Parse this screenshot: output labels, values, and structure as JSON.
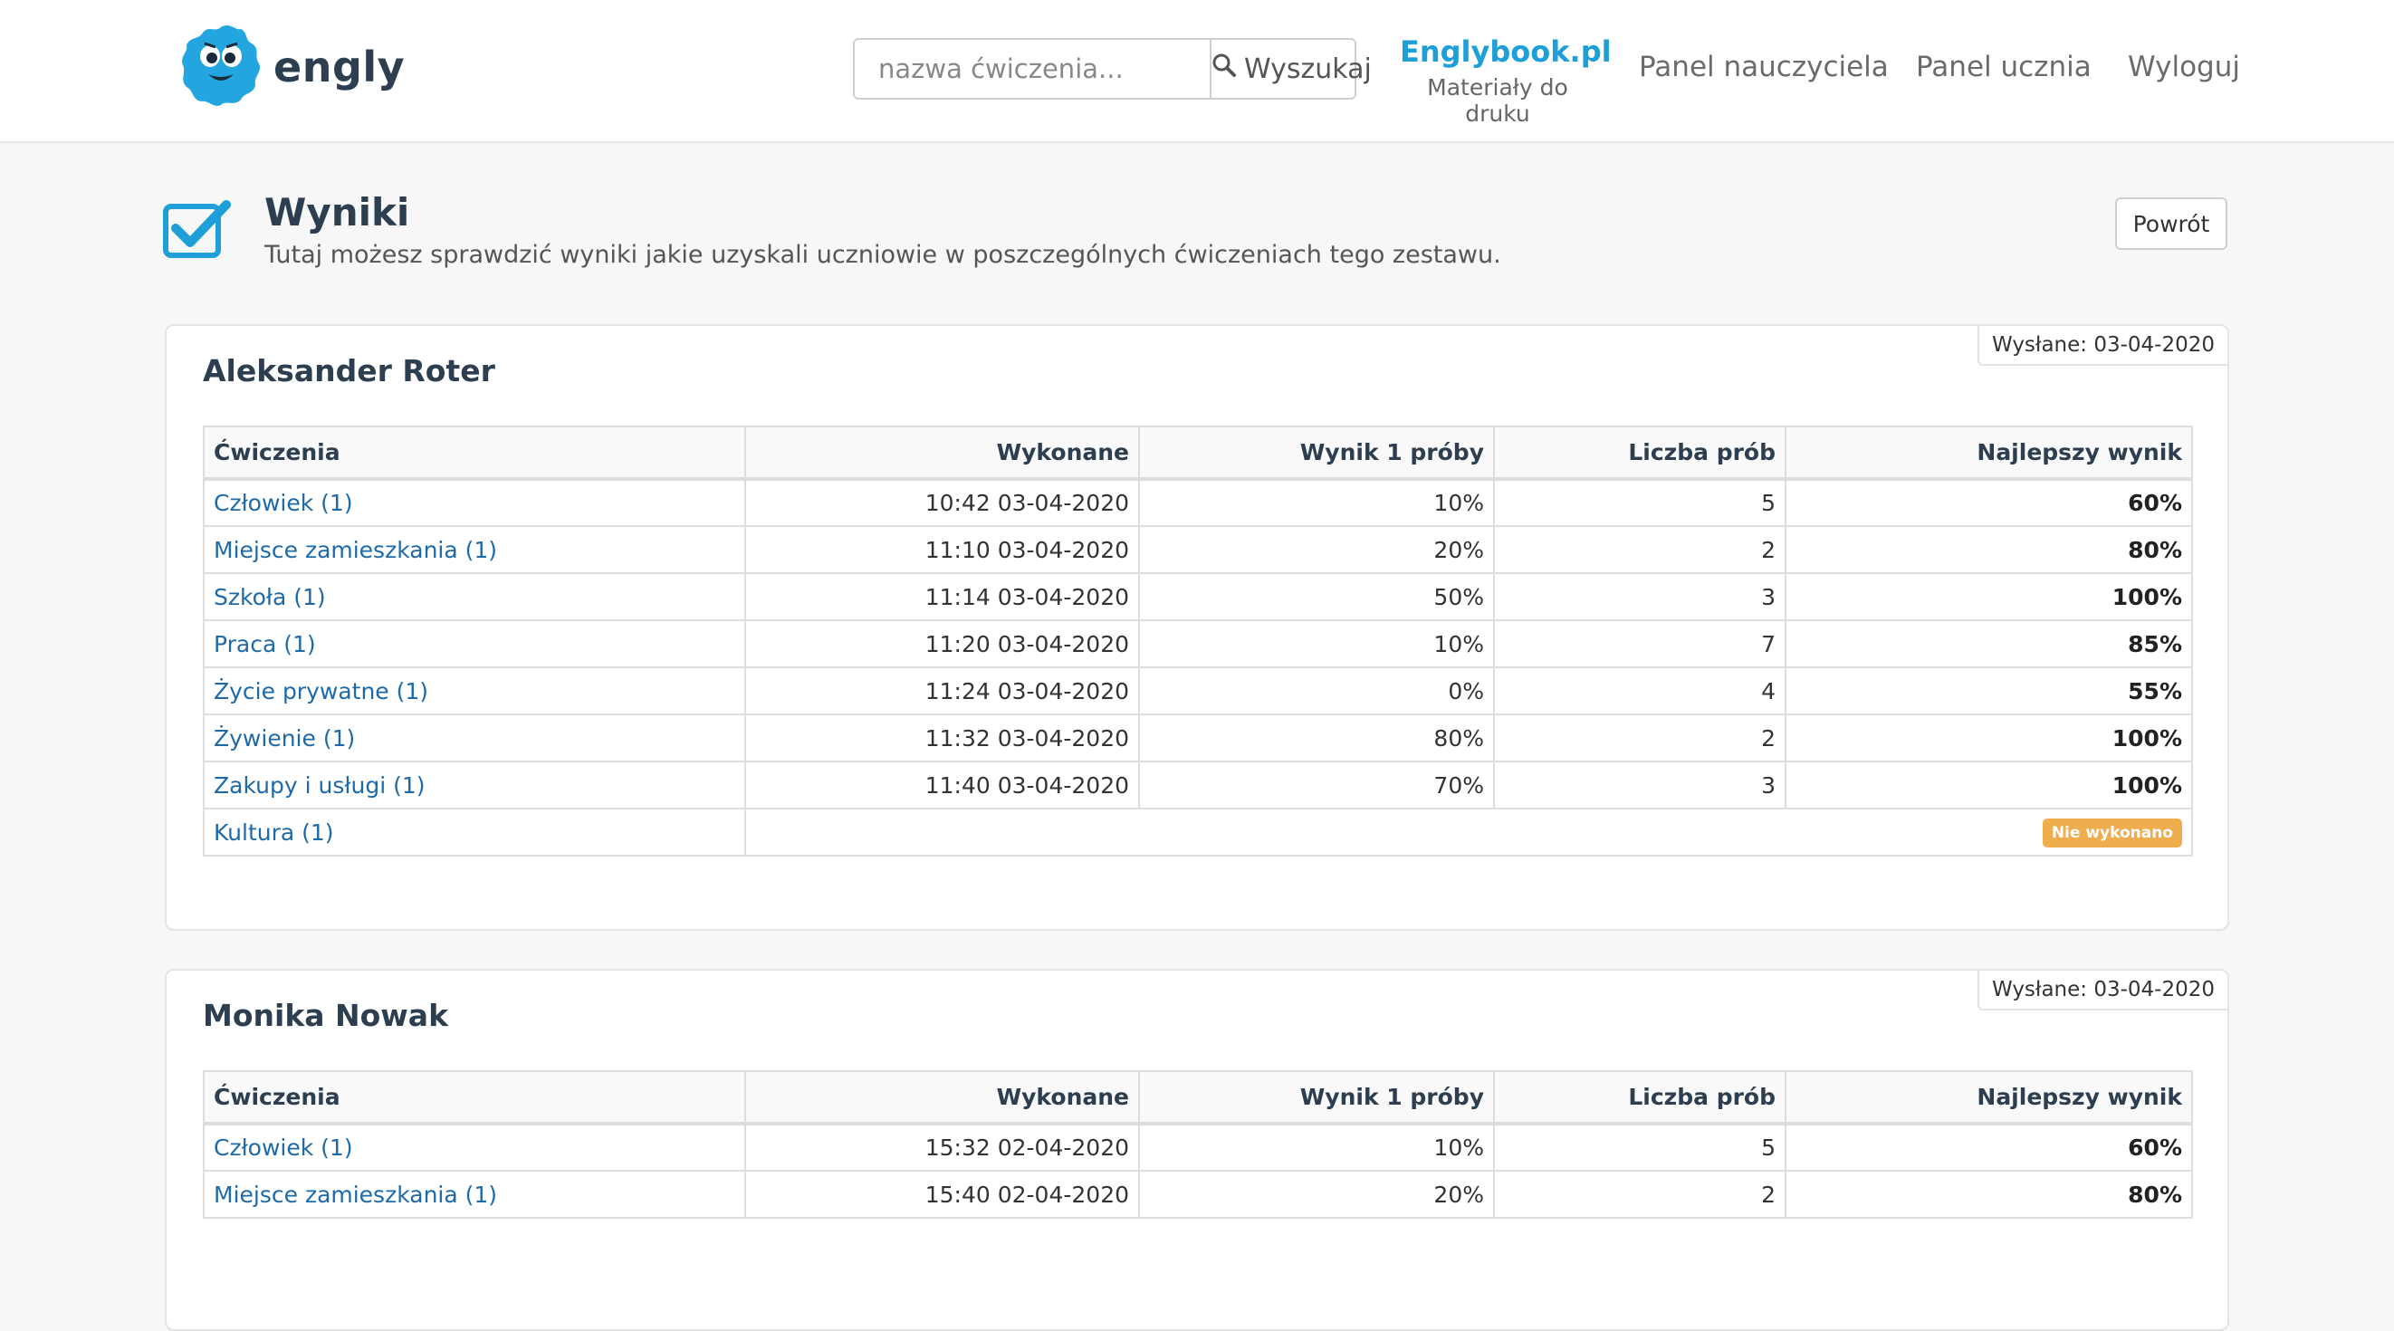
{
  "header": {
    "logo_text": "engly",
    "search_placeholder": "nazwa ćwiczenia...",
    "search_button": "Wyszukaj",
    "brand_title": "Englybook.pl",
    "brand_subtitle": "Materiały do druku",
    "nav_teacher": "Panel nauczyciela",
    "nav_student": "Panel ucznia",
    "nav_logout": "Wyloguj"
  },
  "page": {
    "title": "Wyniki",
    "subtitle": "Tutaj możesz sprawdzić wyniki jakie uzyskali uczniowie w poszczególnych ćwiczeniach tego zestawu.",
    "back_button": "Powrót"
  },
  "table_headers": {
    "exercise": "Ćwiczenia",
    "done": "Wykonane",
    "first_score": "Wynik 1 próby",
    "attempts": "Liczba prób",
    "best_score": "Najlepszy wynik"
  },
  "students": [
    {
      "name": "Aleksander Roter",
      "sent": "Wysłane: 03-04-2020",
      "rows": [
        {
          "exercise": "Człowiek (1)",
          "done": "10:42 03-04-2020",
          "first": "10%",
          "attempts": "5",
          "best": "60%"
        },
        {
          "exercise": "Miejsce zamieszkania (1)",
          "done": "11:10 03-04-2020",
          "first": "20%",
          "attempts": "2",
          "best": "80%"
        },
        {
          "exercise": "Szkoła (1)",
          "done": "11:14 03-04-2020",
          "first": "50%",
          "attempts": "3",
          "best": "100%"
        },
        {
          "exercise": "Praca (1)",
          "done": "11:20 03-04-2020",
          "first": "10%",
          "attempts": "7",
          "best": "85%"
        },
        {
          "exercise": "Życie prywatne (1)",
          "done": "11:24 03-04-2020",
          "first": "0%",
          "attempts": "4",
          "best": "55%"
        },
        {
          "exercise": "Żywienie (1)",
          "done": "11:32 03-04-2020",
          "first": "80%",
          "attempts": "2",
          "best": "100%"
        },
        {
          "exercise": "Zakupy i usługi (1)",
          "done": "11:40 03-04-2020",
          "first": "70%",
          "attempts": "3",
          "best": "100%"
        }
      ],
      "not_done_row": {
        "exercise": "Kultura (1)",
        "badge": "Nie wykonano"
      }
    },
    {
      "name": "Monika Nowak",
      "sent": "Wysłane: 03-04-2020",
      "rows": [
        {
          "exercise": "Człowiek (1)",
          "done": "15:32 02-04-2020",
          "first": "10%",
          "attempts": "5",
          "best": "60%"
        },
        {
          "exercise": "Miejsce zamieszkania (1)",
          "done": "15:40 02-04-2020",
          "first": "20%",
          "attempts": "2",
          "best": "80%"
        }
      ]
    }
  ],
  "colors": {
    "accent": "#1e9fd8",
    "link": "#1e6aa8",
    "warning_badge": "#f0ad4e",
    "background": "#f7f7f7"
  },
  "icons": [
    "monster-logo-icon",
    "search-icon",
    "checkbox-checked-icon"
  ]
}
